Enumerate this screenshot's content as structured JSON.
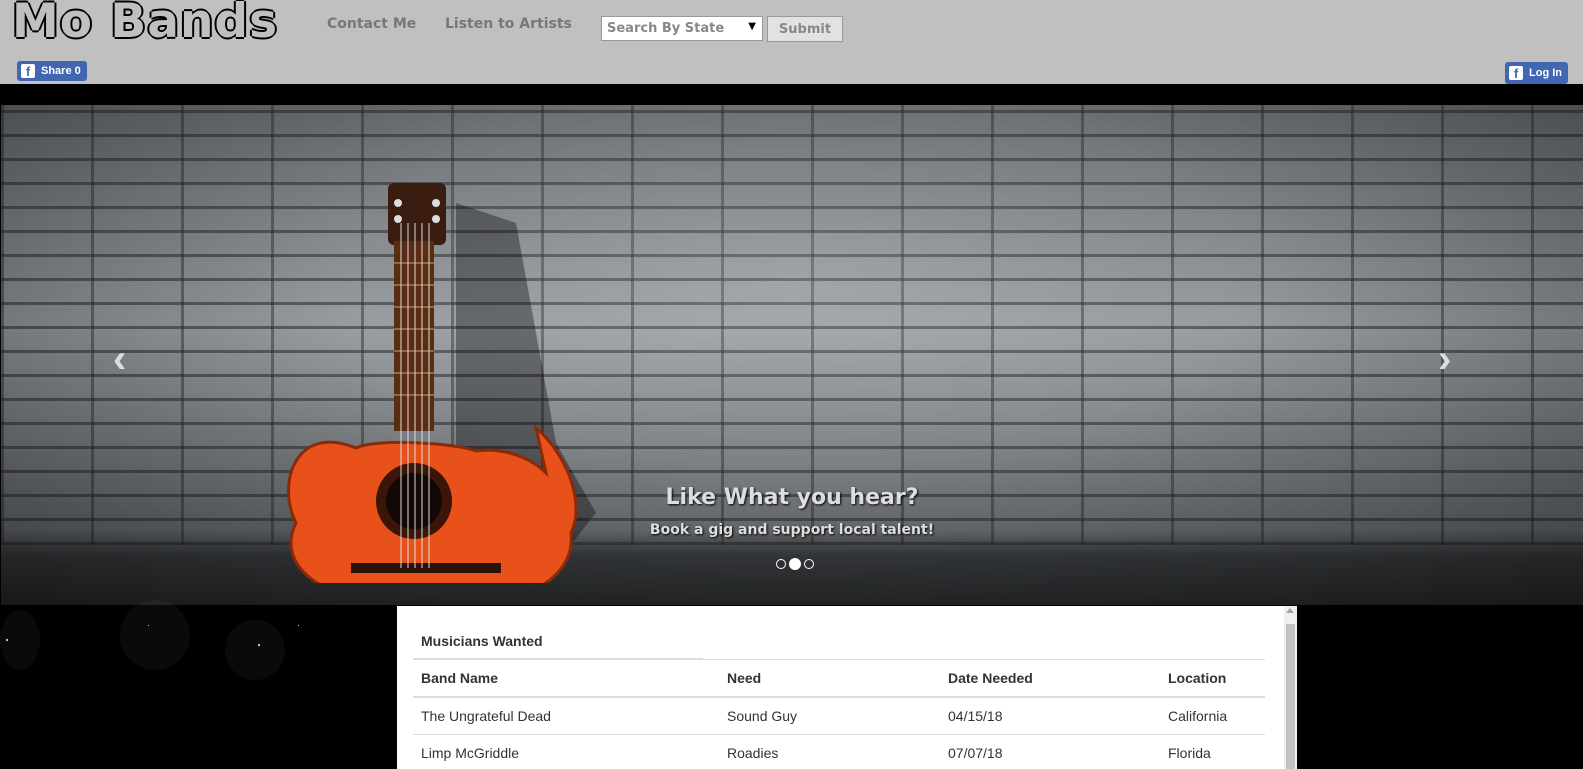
{
  "header": {
    "logo": "Mo Bands",
    "nav": [
      "Contact Me",
      "Listen to Artists"
    ],
    "search": {
      "placeholder": "Search By State"
    },
    "submit_label": "Submit",
    "fb_share": "Share 0",
    "fb_login": "Log In"
  },
  "carousel": {
    "title": "Like What you hear?",
    "subtitle": "Book a gig and support local talent!",
    "slide_count": 3,
    "active_slide": 2,
    "prev_icon": "chevron-left-icon",
    "next_icon": "chevron-right-icon"
  },
  "table": {
    "title": "Musicians Wanted",
    "headers": [
      "Band Name",
      "Need",
      "Date Needed",
      "Location"
    ],
    "rows": [
      [
        "The Ungrateful Dead",
        "Sound Guy",
        "04/15/18",
        "California"
      ],
      [
        "Limp McGriddle",
        "Roadies",
        "07/07/18",
        "Florida"
      ]
    ]
  },
  "colors": {
    "header_bg": "#c0c0c0",
    "page_bg": "#000000",
    "facebook": "#4267b2"
  }
}
